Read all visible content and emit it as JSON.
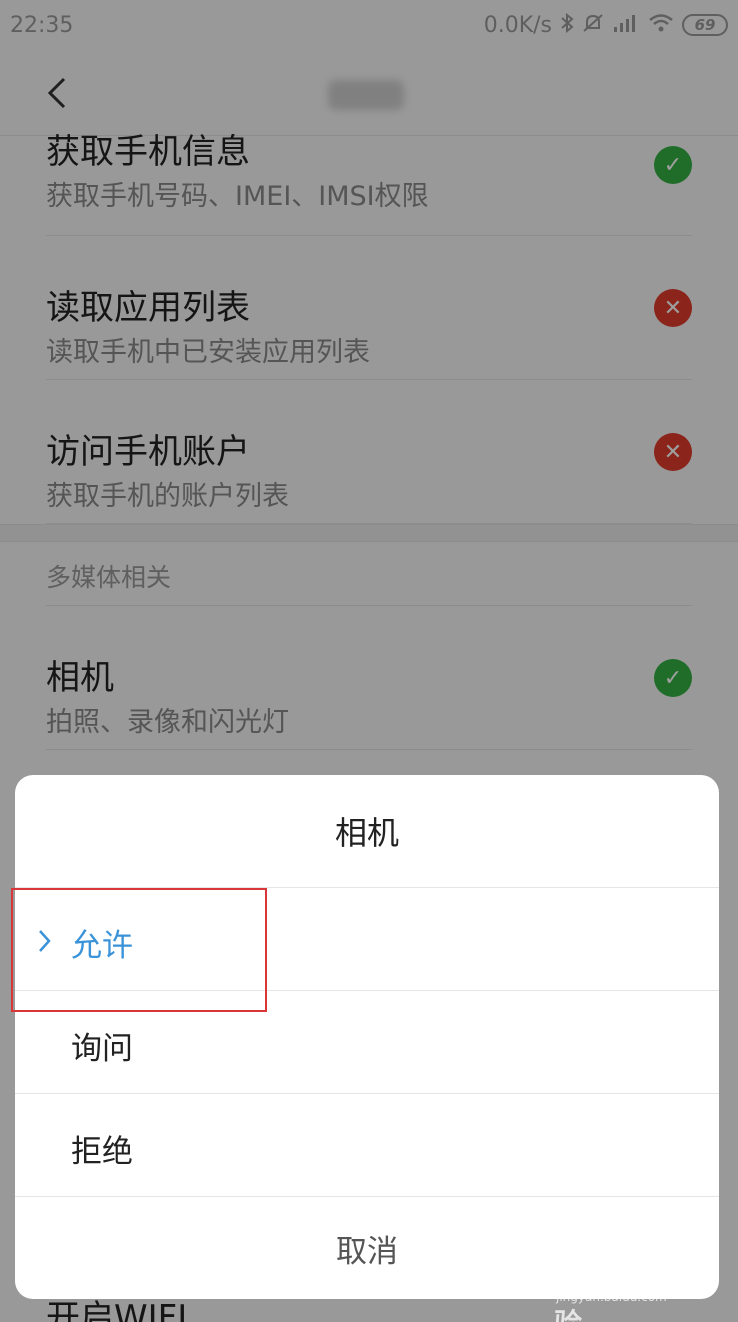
{
  "status_bar": {
    "time": "22:35",
    "net_speed": "0.0K/s",
    "battery": "69",
    "icons": [
      "bluetooth-icon",
      "mute-icon",
      "signal-icon",
      "wifi-icon",
      "battery-icon"
    ]
  },
  "header": {
    "back_icon": "chevron-left-icon"
  },
  "permissions": [
    {
      "title": "获取手机信息",
      "desc": "获取手机号码、IMEI、IMSI权限",
      "status": "allowed"
    },
    {
      "title": "读取应用列表",
      "desc": "读取手机中已安装应用列表",
      "status": "denied"
    },
    {
      "title": "访问手机账户",
      "desc": "获取手机的账户列表",
      "status": "denied"
    }
  ],
  "media_section": {
    "header": "多媒体相关",
    "items": [
      {
        "title": "相机",
        "desc": "拍照、录像和闪光灯",
        "status": "allowed"
      }
    ]
  },
  "bottom_peek": "开启WIFI",
  "dialog": {
    "title": "相机",
    "options": [
      {
        "label": "允许",
        "selected": true
      },
      {
        "label": "询问",
        "selected": false
      },
      {
        "label": "拒绝",
        "selected": false
      }
    ],
    "cancel": "取消"
  },
  "colors": {
    "accent": "#3a93d8",
    "allowed": "#33b043",
    "denied": "#e13b2a",
    "highlight": "#d9363a"
  },
  "watermark": {
    "brand": "Bai du 经验",
    "url": "jingyan.baidu.com"
  }
}
